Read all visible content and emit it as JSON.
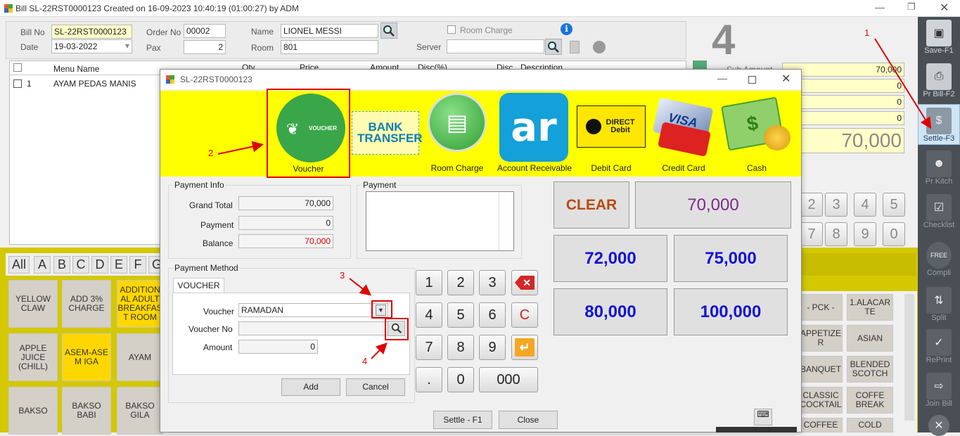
{
  "window": {
    "title": "Bill SL-22RST0000123 Created on 16-09-2023 10:40:19 (01:00:27) by ADM"
  },
  "header": {
    "bill_no_label": "Bill No",
    "bill_no": "SL-22RST0000123",
    "date_label": "Date",
    "date": "19-03-2022",
    "order_no_label": "Order No",
    "order_no": "00002",
    "pax_label": "Pax",
    "pax": "2",
    "name_label": "Name",
    "name": "LIONEL MESSI",
    "room_label": "Room",
    "room": "801",
    "room_charge_label": "Room Charge",
    "server_label": "Server",
    "table_number": "4"
  },
  "order_table": {
    "columns": [
      "Menu Name",
      "Qty",
      "Price",
      "Amount",
      "Disc(%)",
      "Disc",
      "Description"
    ],
    "rows": [
      {
        "no": "1",
        "menu": "AYAM PEDAS MANIS"
      }
    ]
  },
  "totals": {
    "sub_amount_label": "Sub Amount",
    "sub_amount": "70,000",
    "row2": "0",
    "row3": "0",
    "row4": "0",
    "grand": "70,000"
  },
  "numpad_bg": [
    "2",
    "3",
    "4",
    "5",
    "7",
    "8",
    "9",
    "0"
  ],
  "categories": [
    "All",
    "A",
    "B",
    "C",
    "D",
    "E",
    "F",
    "G"
  ],
  "menu_items": [
    "YELLOW CLAW",
    "ADD 3% CHARGE",
    "ADDITION AL ADULT BREAKFAS T ROOM",
    "APPLE JUICE (CHILL)",
    "ASEM-ASE M IGA",
    "AYAM",
    "BAKSO",
    "BAKSO BABI",
    "BAKSO GILA"
  ],
  "right_menu": [
    "- PCK -",
    "1.ALACAR TE",
    "APPETIZE R",
    "ASIAN",
    "BANQUET",
    "BLENDED SCOTCH",
    "CLASSIC COCKTAIL",
    "COFFE BREAK",
    "COFFEE",
    "COLD"
  ],
  "sidebar": [
    {
      "label": "Save-F1",
      "icon": "save-icon"
    },
    {
      "label": "Pr Bill-F2",
      "icon": "printer-icon"
    },
    {
      "label": "Settle-F3",
      "icon": "money-icon"
    },
    {
      "label": "Pr Kitch",
      "icon": "chef-icon"
    },
    {
      "label": "Checklist",
      "icon": "clipboard-icon"
    },
    {
      "label": "Compli",
      "icon": "free-badge-icon"
    },
    {
      "label": "Split",
      "icon": "split-icon"
    },
    {
      "label": "RePrint",
      "icon": "reprint-icon"
    },
    {
      "label": "Join Bill",
      "icon": "join-icon"
    }
  ],
  "dialog": {
    "title": "SL-22RST0000123",
    "payment_types": [
      {
        "label": "Voucher",
        "icon": "voucher-icon",
        "badge": "VOUCHER"
      },
      {
        "label": "",
        "icon": "bank-transfer-icon",
        "badge": "BANK TRANSFER"
      },
      {
        "label": "Room Charge",
        "icon": "bed-icon"
      },
      {
        "label": "Account Receivable",
        "icon": "ar-icon",
        "badge": "ar"
      },
      {
        "label": "Debit Card",
        "icon": "direct-debit-icon",
        "badge": "DIRECT Debit"
      },
      {
        "label": "Credit Card",
        "icon": "credit-card-icon",
        "badge": "VISA"
      },
      {
        "label": "Cash",
        "icon": "cash-icon"
      }
    ],
    "payment_info": {
      "title": "Payment Info",
      "grand_total_label": "Grand Total",
      "grand_total": "70,000",
      "payment_label": "Payment",
      "payment": "0",
      "balance_label": "Balance",
      "balance": "70,000"
    },
    "payment_box_title": "Payment",
    "payment_method": {
      "title": "Payment Method",
      "tab": "VOUCHER",
      "voucher_label": "Voucher",
      "voucher": "RAMADAN",
      "voucher_no_label": "Voucher No",
      "voucher_no": "",
      "amount_label": "Amount",
      "amount": "0",
      "add": "Add",
      "cancel": "Cancel"
    },
    "keypad": [
      "1",
      "2",
      "3",
      "4",
      "5",
      "6",
      "C",
      "7",
      "8",
      "9",
      ".",
      "0",
      "000"
    ],
    "quick": {
      "clear": "CLEAR",
      "exact": "70,000",
      "q1": "72,000",
      "q2": "75,000",
      "q3": "80,000",
      "q4": "100,000"
    },
    "settle": "Settle - F1",
    "close": "Close"
  },
  "annotations": [
    "1",
    "2",
    "3",
    "4"
  ],
  "colors": {
    "yellow": "#ffff00",
    "annotation_red": "#e00000",
    "quick_blue": "#1414d2",
    "clear_text": "#b84a12",
    "exact_text": "#7d2a8a"
  }
}
